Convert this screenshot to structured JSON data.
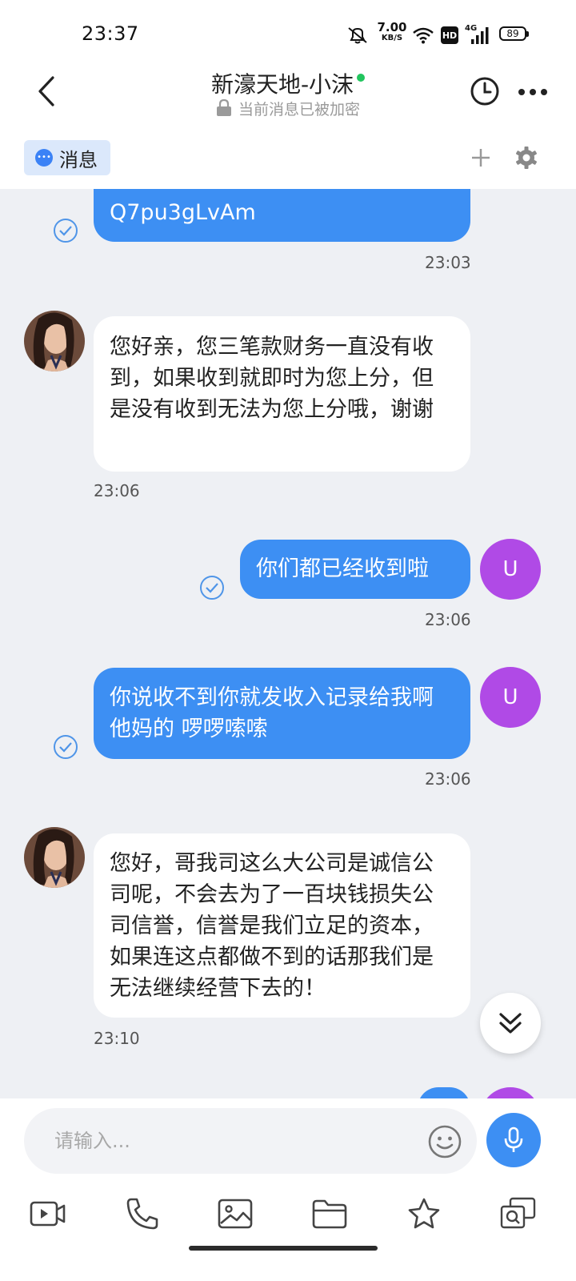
{
  "status_bar": {
    "time": "23:37",
    "net_speed_value": "7.00",
    "net_speed_unit": "KB/S",
    "hd_label": "HD",
    "network_label": "4G",
    "battery": "89"
  },
  "header": {
    "title": "新濠天地-小沫",
    "subtitle": "当前消息已被加密"
  },
  "toolbar": {
    "tab_label": "消息"
  },
  "messages": [
    {
      "side": "out",
      "text": "Q7pu3gLvAm",
      "time": "23:03"
    },
    {
      "side": "in",
      "text": "您好亲，您三笔款财务一直没有收到，如果收到就即时为您上分，但是没有收到无法为您上分哦，谢谢",
      "time": "23:06"
    },
    {
      "side": "out",
      "text": "你们都已经收到啦",
      "time": "23:06",
      "avatar": "U"
    },
    {
      "side": "out",
      "text": "你说收不到你就发收入记录给我啊 他妈的 啰啰嗦嗦",
      "time": "23:06",
      "avatar": "U"
    },
    {
      "side": "in",
      "text": "您好，哥我司这么大公司是诚信公司呢，不会去为了一百块钱损失公司信誉，信誉是我们立足的资本，如果连这点都做不到的话那我们是无法继续经营下去的！",
      "time": "23:10"
    }
  ],
  "input": {
    "placeholder": "请输入..."
  },
  "icons": [
    "back-icon",
    "clock-icon",
    "more-icon",
    "add-icon",
    "gear-icon",
    "check-icon",
    "emoji-icon",
    "mic-icon",
    "video-icon",
    "phone-icon",
    "image-icon",
    "folder-icon",
    "star-icon",
    "search-card-icon",
    "chevron-double-down-icon"
  ],
  "colors": {
    "accent": "#3d8ff3",
    "user_avatar": "#b04ae6",
    "chat_bg": "#eef0f4",
    "online": "#22c55e"
  }
}
